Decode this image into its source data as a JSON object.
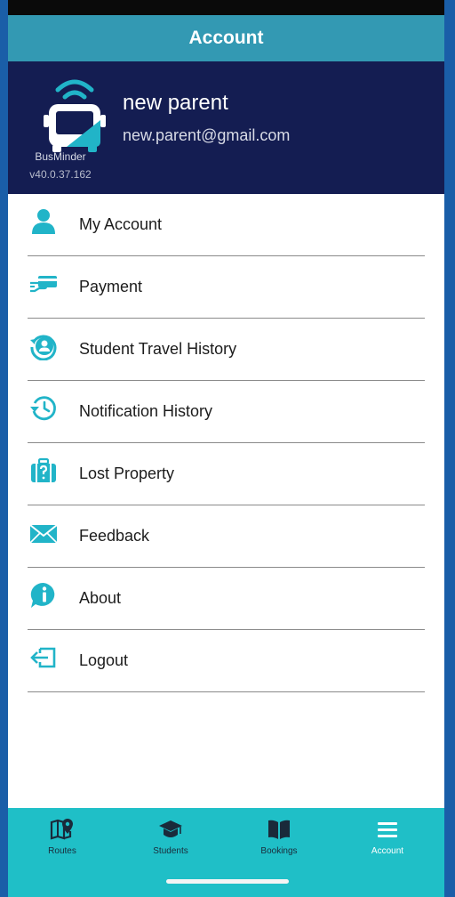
{
  "header": {
    "title": "Account"
  },
  "profile": {
    "name": "new parent",
    "email": "new.parent@gmail.com",
    "brand": "BusMinder",
    "version": "v40.0.37.162"
  },
  "menu": {
    "items": [
      {
        "label": "My Account",
        "icon": "person-icon"
      },
      {
        "label": "Payment",
        "icon": "payment-card-icon"
      },
      {
        "label": "Student Travel History",
        "icon": "student-history-icon"
      },
      {
        "label": "Notification History",
        "icon": "history-clock-icon"
      },
      {
        "label": "Lost Property",
        "icon": "lost-luggage-icon"
      },
      {
        "label": "Feedback",
        "icon": "envelope-icon"
      },
      {
        "label": "About",
        "icon": "info-icon"
      },
      {
        "label": "Logout",
        "icon": "logout-icon"
      }
    ]
  },
  "tabbar": {
    "tabs": [
      {
        "label": "Routes",
        "icon": "map-pin-icon"
      },
      {
        "label": "Students",
        "icon": "graduation-cap-icon"
      },
      {
        "label": "Bookings",
        "icon": "open-book-icon"
      },
      {
        "label": "Account",
        "icon": "menu-icon",
        "active": true
      }
    ]
  },
  "colors": {
    "title_bar": "#3399b3",
    "profile_bg": "#141d52",
    "accent": "#21b4c8",
    "tab_bar": "#1fbfc7",
    "frame": "#1a5ea8"
  }
}
